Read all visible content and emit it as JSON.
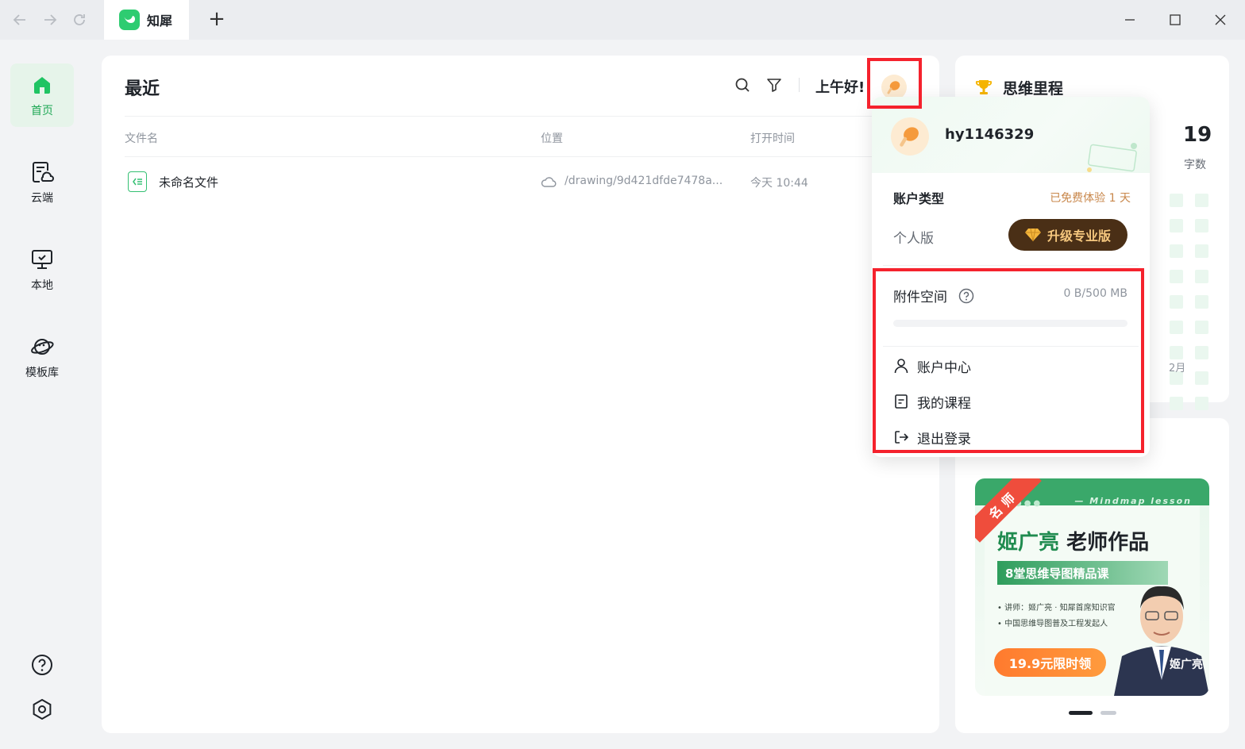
{
  "app": {
    "tab_label": "知犀",
    "new_tab": "+"
  },
  "sidebar": {
    "items": [
      {
        "label": "首页"
      },
      {
        "label": "云端"
      },
      {
        "label": "本地"
      },
      {
        "label": "模板库"
      }
    ]
  },
  "main": {
    "title": "最近",
    "greeting": "上午好!",
    "columns": [
      "文件名",
      "位置",
      "打开时间"
    ],
    "rows": [
      {
        "name": "未命名文件",
        "location": "/drawing/9d421dfde7478a...",
        "time": "今天 10:44"
      }
    ]
  },
  "milestone": {
    "title": "思维里程",
    "stat_value": "19",
    "stat_label": "字数",
    "month_label": "2月"
  },
  "banner": {
    "corner_tag": "名师",
    "tagline": "— Mindmap lesson",
    "title_a": "姬广亮",
    "title_b": " 老师作品",
    "strip": "8堂思维导图精品课",
    "bullets": [
      "讲师：姬广亮 · 知犀首席知识官",
      "中国思维导图普及工程发起人"
    ],
    "cta": "19.9元限时领",
    "person_name": "姬广亮"
  },
  "popup": {
    "username": "hy1146329",
    "account_type_label": "账户类型",
    "trial_text": "已免费体验 1 天",
    "plan": "个人版",
    "upgrade_label": "升级专业版",
    "attachment_label": "附件空间",
    "attachment_size": "0 B/500 MB",
    "attachment_used_fraction": 0,
    "menu": [
      {
        "label": "账户中心",
        "icon": "user-icon"
      },
      {
        "label": "我的课程",
        "icon": "course-icon"
      },
      {
        "label": "退出登录",
        "icon": "logout-icon"
      }
    ]
  },
  "colors": {
    "accent_green": "#1fa855",
    "highlight_red": "#f5222d",
    "upgrade_bg": "#4a2f16"
  }
}
